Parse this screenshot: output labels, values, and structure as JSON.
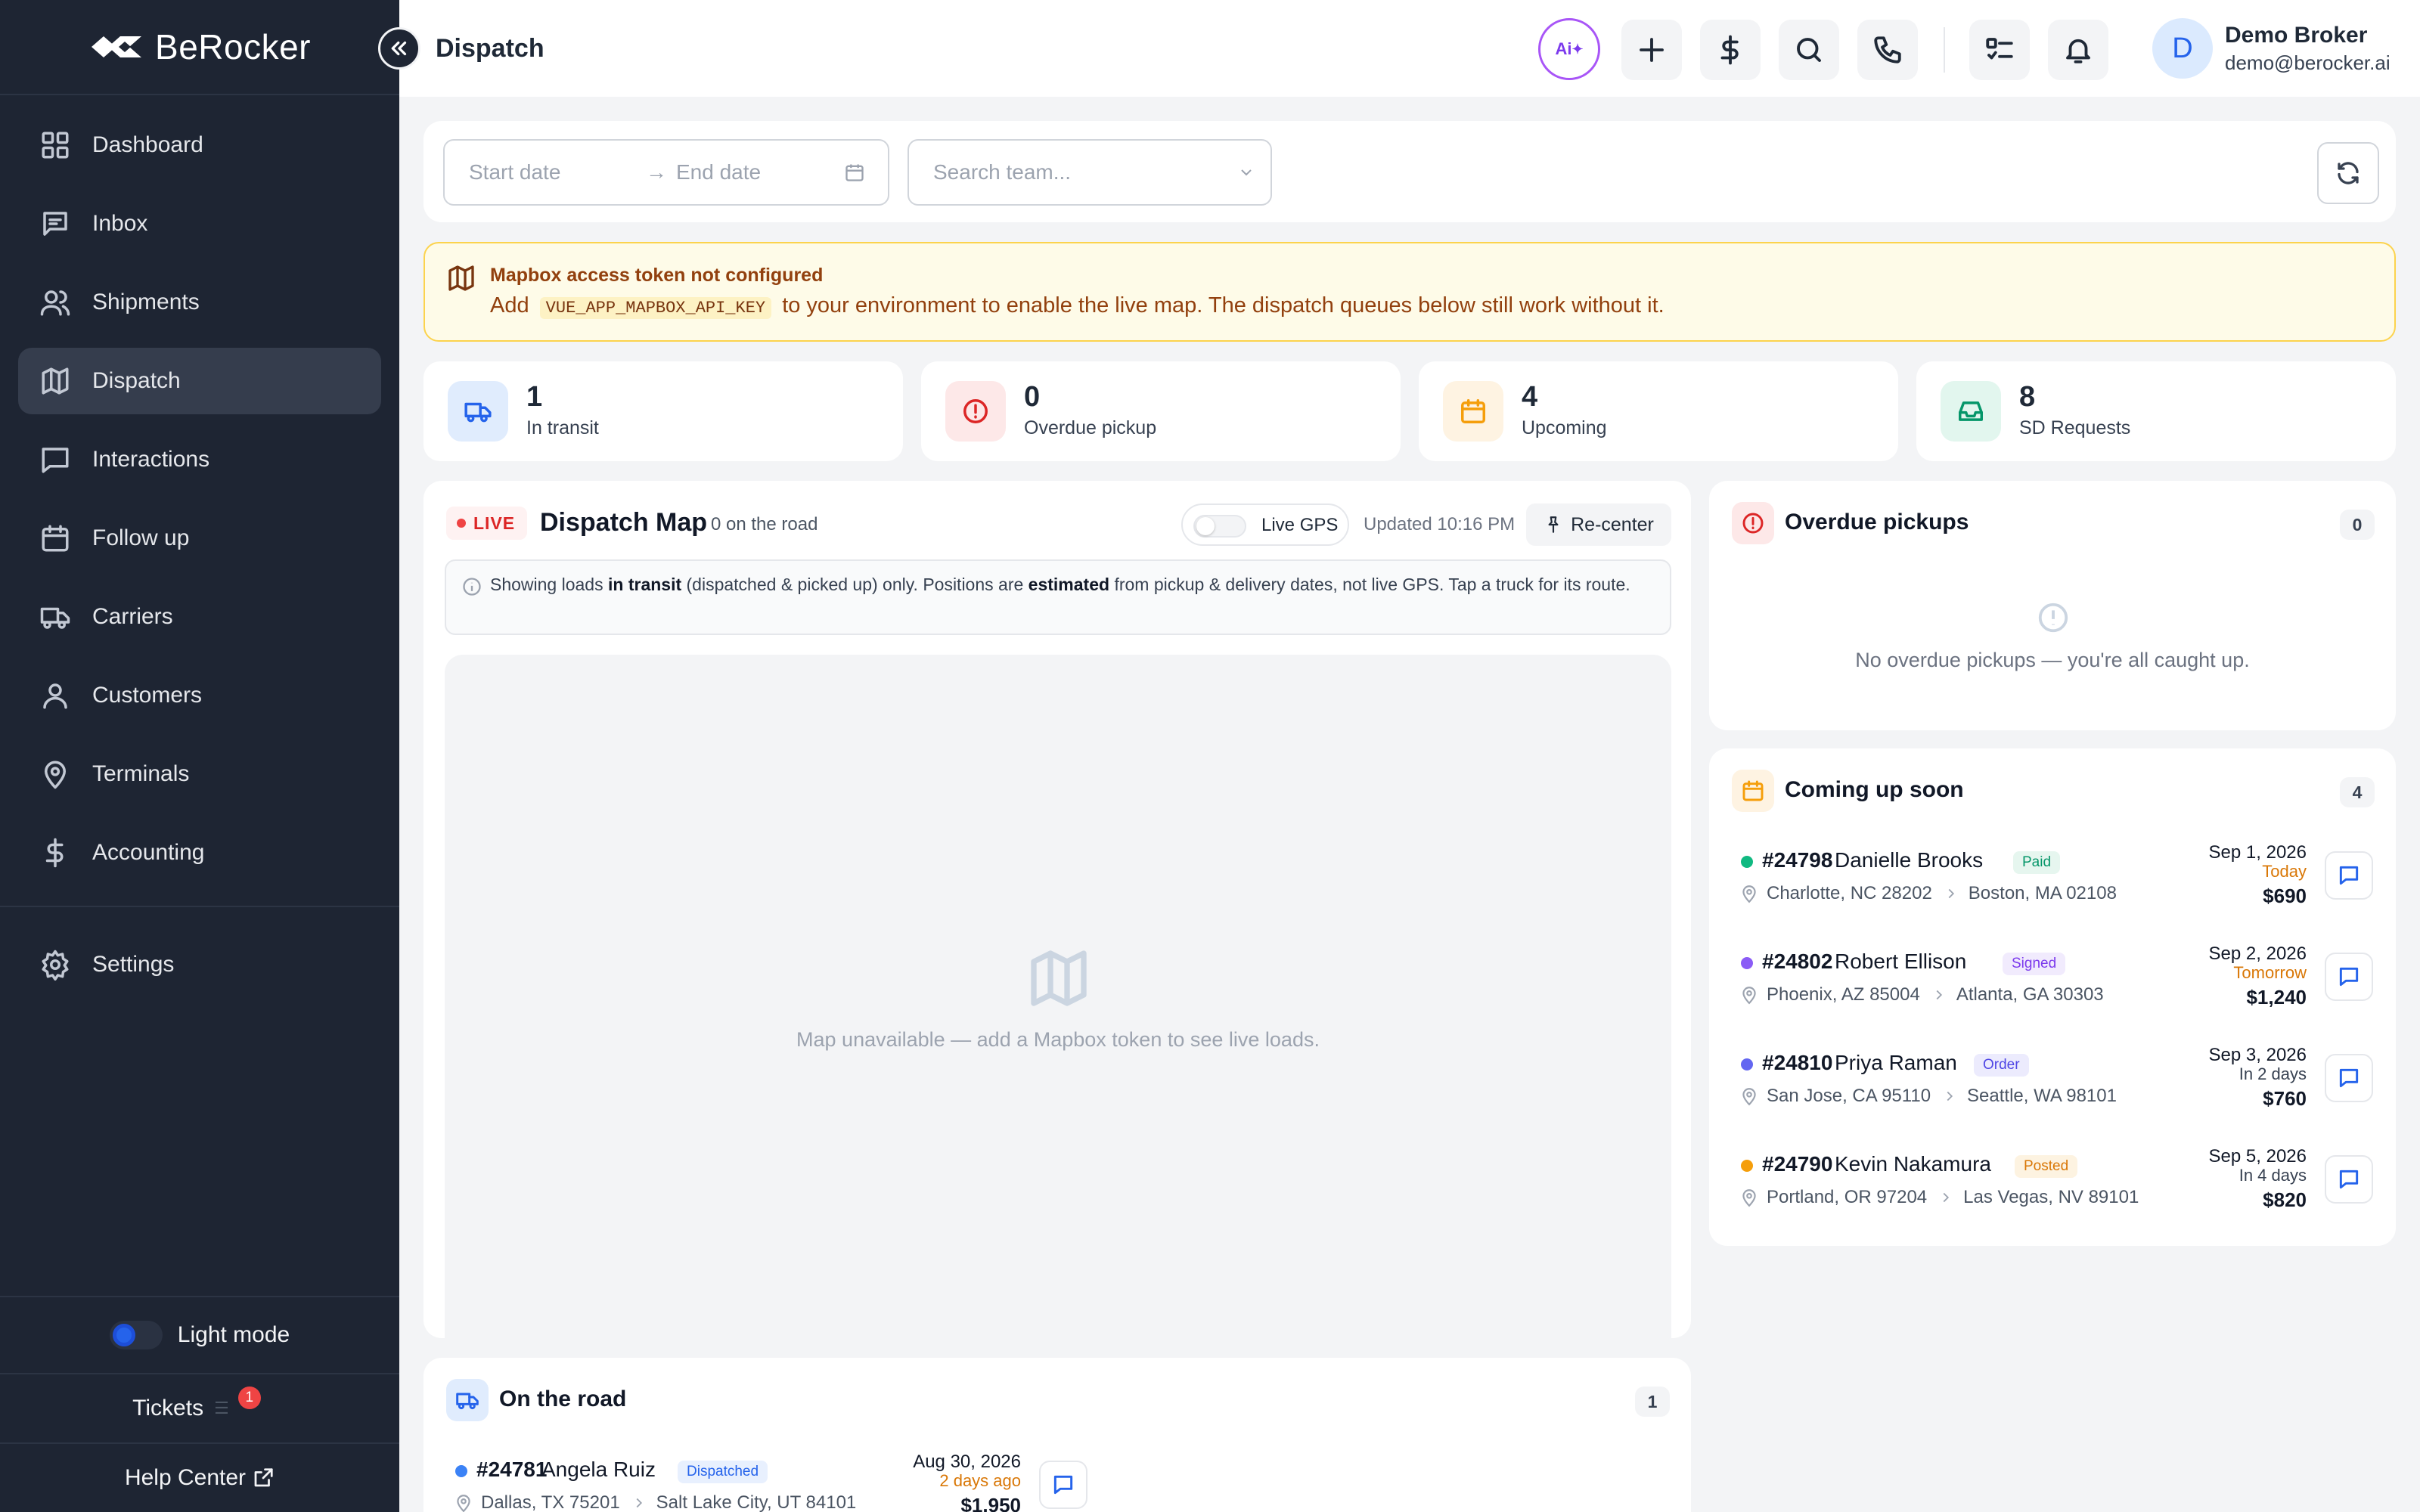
{
  "brand": {
    "name": "BeRocker"
  },
  "sidebar": {
    "items": [
      {
        "label": "Dashboard",
        "icon": "grid-icon",
        "active": false
      },
      {
        "label": "Inbox",
        "icon": "inbox-icon",
        "active": false
      },
      {
        "label": "Shipments",
        "icon": "users-icon",
        "active": false
      },
      {
        "label": "Dispatch",
        "icon": "map-icon",
        "active": true
      },
      {
        "label": "Interactions",
        "icon": "chat-icon",
        "active": false
      },
      {
        "label": "Follow up",
        "icon": "calendar-icon",
        "active": false
      },
      {
        "label": "Carriers",
        "icon": "truck-icon",
        "active": false
      },
      {
        "label": "Customers",
        "icon": "user-icon",
        "active": false
      },
      {
        "label": "Terminals",
        "icon": "location-icon",
        "active": false
      },
      {
        "label": "Accounting",
        "icon": "dollar-icon",
        "active": false
      }
    ],
    "settings": {
      "label": "Settings"
    },
    "light_mode": {
      "label": "Light mode"
    },
    "tickets": {
      "label": "Tickets",
      "count": "1"
    },
    "help": {
      "label": "Help Center"
    }
  },
  "header": {
    "title": "Dispatch",
    "ai_label": "Ai",
    "user": {
      "initial": "D",
      "name": "Demo Broker",
      "email": "demo@berocker.ai"
    }
  },
  "filters": {
    "start_placeholder": "Start date",
    "arrow": "→",
    "end_placeholder": "End date",
    "team_placeholder": "Search team..."
  },
  "alert": {
    "title": "Mapbox access token not configured",
    "prefix": "Add",
    "code": "VUE_APP_MAPBOX_API_KEY",
    "suffix": "to your environment to enable the live map. The dispatch queues below still work without it."
  },
  "stats": [
    {
      "value": "1",
      "label": "In transit",
      "color": "#2563eb",
      "bg": "#e0ecfd"
    },
    {
      "value": "0",
      "label": "Overdue pickup",
      "color": "#dc2626",
      "bg": "#fde8e8"
    },
    {
      "value": "4",
      "label": "Upcoming",
      "color": "#f59e0b",
      "bg": "#fef3e2"
    },
    {
      "value": "8",
      "label": "SD Requests",
      "color": "#059669",
      "bg": "#e2f6ee"
    }
  ],
  "map": {
    "live_label": "LIVE",
    "title": "Dispatch Map",
    "subtitle": "0 on the road",
    "gps_label": "Live GPS",
    "updated": "Updated 10:16 PM",
    "recenter_label": "Re-center",
    "info": {
      "p1": "Showing loads",
      "b1": "in transit",
      "p2": "(dispatched & picked up) only. Positions are",
      "b2": "estimated",
      "p3": "from pickup & delivery dates, not live GPS. Tap a truck for its route."
    },
    "unavailable": "Map unavailable — add a Mapbox token to see live loads."
  },
  "overdue": {
    "title": "Overdue pickups",
    "count": "0",
    "empty": "No overdue pickups — you're all caught up."
  },
  "coming": {
    "title": "Coming up soon",
    "count": "4",
    "rows": [
      {
        "id": "#24798",
        "name": "Danielle Brooks",
        "tag": "Paid",
        "tag_color": "#059669",
        "tag_bg": "#e6f6ef",
        "dot": "#10b981",
        "from": "Charlotte, NC 28202",
        "to": "Boston, MA 02108",
        "date": "Sep 1, 2026",
        "rel": "Today",
        "rel_color": "#d97706",
        "amount": "$690"
      },
      {
        "id": "#24802",
        "name": "Robert Ellison",
        "tag": "Signed",
        "tag_color": "#7c3aed",
        "tag_bg": "#f1ebfd",
        "dot": "#8b5cf6",
        "from": "Phoenix, AZ 85004",
        "to": "Atlanta, GA 30303",
        "date": "Sep 2, 2026",
        "rel": "Tomorrow",
        "rel_color": "#d97706",
        "amount": "$1,240"
      },
      {
        "id": "#24810",
        "name": "Priya Raman",
        "tag": "Order",
        "tag_color": "#4f46e5",
        "tag_bg": "#ecebfd",
        "dot": "#6366f1",
        "from": "San Jose, CA 95110",
        "to": "Seattle, WA 98101",
        "date": "Sep 3, 2026",
        "rel": "In 2 days",
        "rel_color": "#374151",
        "amount": "$760"
      },
      {
        "id": "#24790",
        "name": "Kevin Nakamura",
        "tag": "Posted",
        "tag_color": "#d97706",
        "tag_bg": "#fdf3e1",
        "dot": "#f59e0b",
        "from": "Portland, OR 97204",
        "to": "Las Vegas, NV 89101",
        "date": "Sep 5, 2026",
        "rel": "In 4 days",
        "rel_color": "#374151",
        "amount": "$820"
      }
    ]
  },
  "road": {
    "title": "On the road",
    "count": "1",
    "rows": [
      {
        "id": "#24781",
        "name": "Angela Ruiz",
        "tag": "Dispatched",
        "tag_color": "#2563eb",
        "tag_bg": "#e8f0fe",
        "dot": "#3b82f6",
        "from": "Dallas, TX 75201",
        "to": "Salt Lake City, UT 84101",
        "date": "Aug 30, 2026",
        "rel": "2 days ago",
        "rel_color": "#d97706",
        "amount": "$1,950"
      }
    ]
  }
}
